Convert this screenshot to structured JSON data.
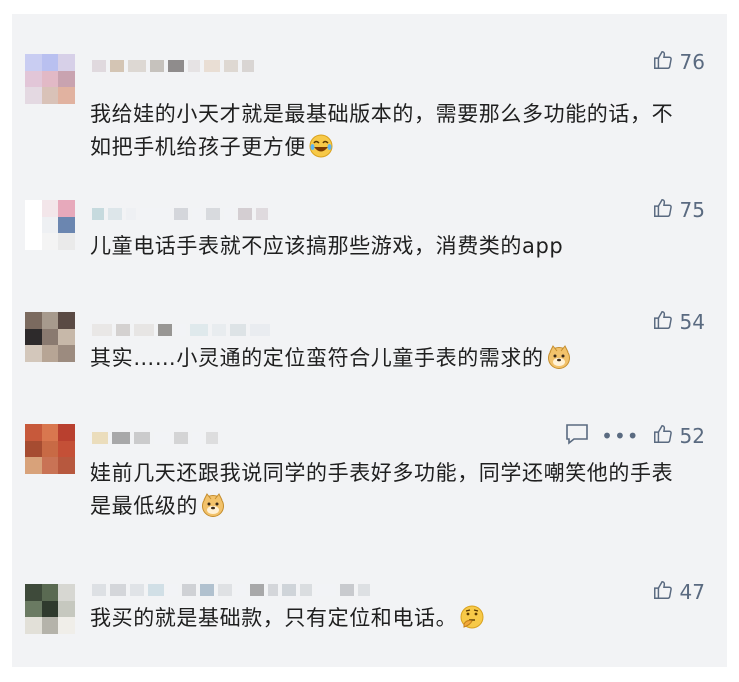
{
  "comments": [
    {
      "text": "我给娃的小天才就是最基础版本的，需要那么多功能的话，不如把手机给孩子更方便",
      "likes": "76",
      "emoji": "laughing-tears-emoji",
      "avatar_colors": [
        "#c9cdf2",
        "#b9c0f0",
        "#d7d0e8",
        "#e2c6d8",
        "#e2b9c6",
        "#c9a3b0",
        "#e4d9e2",
        "#d9c2b8",
        "#e1b2a0"
      ]
    },
    {
      "text": "儿童电话手表就不应该搞那些游戏，消费类的app",
      "likes": "75",
      "emoji": "",
      "avatar_colors": [
        "#ffffff",
        "#f3e6ea",
        "#e7a9bb",
        "#ffffff",
        "#eef0f3",
        "#6b86b0",
        "#ffffff",
        "#f4f4f4",
        "#eaeaea"
      ]
    },
    {
      "text": "其实……小灵通的定位蛮符合儿童手表的需求的",
      "likes": "54",
      "emoji": "doge-emoji",
      "avatar_colors": [
        "#7b6a5f",
        "#a79a8d",
        "#5a4a44",
        "#2d2a2b",
        "#8a7a70",
        "#c7b8a9",
        "#d3c7bb",
        "#b7a595",
        "#9c8b7f"
      ]
    },
    {
      "text": "娃前几天还跟我说同学的手表好多功能，同学还嘲笑他的手表是最低级的",
      "likes": "52",
      "emoji": "doge-emoji",
      "avatar_colors": [
        "#c7593b",
        "#d9774f",
        "#b9402f",
        "#a64c31",
        "#c86a45",
        "#c45037",
        "#d8a27a",
        "#c97355",
        "#b7583e"
      ]
    },
    {
      "text": "我买的就是基础款，只有定位和电话。",
      "likes": "47",
      "emoji": "thinking-emoji",
      "avatar_colors": [
        "#3e4a3a",
        "#5a6a52",
        "#d7d7d2",
        "#6a7a62",
        "#2f3a2d",
        "#c6c8bf",
        "#e2e0d8",
        "#b5b3aa",
        "#f0eee9"
      ]
    }
  ],
  "colors": {
    "panel_bg": "#f2f3f5",
    "text": "#1f1f1f",
    "icon": "#5a6a80"
  }
}
